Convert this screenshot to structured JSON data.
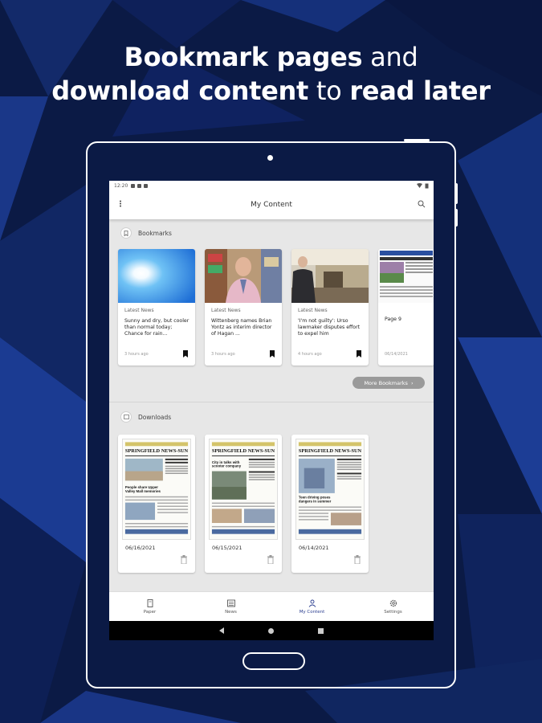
{
  "headline": {
    "line1_bold": "Bookmark pages",
    "line1_light": "and",
    "line2_bold": "download content",
    "line2_light": "to",
    "line2_bold2": "read later"
  },
  "status_bar": {
    "time": "12:20"
  },
  "app_bar": {
    "title": "My Content"
  },
  "bookmarks": {
    "header": "Bookmarks",
    "items": [
      {
        "category": "Latest News",
        "text": "Sunny and dry, but cooler than normal today; Chance for rain...",
        "time": "3 hours ago",
        "image": "sun-sky"
      },
      {
        "category": "Latest News",
        "text": "Wittenberg names Brian Yontz as interim director of Hagan ...",
        "time": "3 hours ago",
        "image": "man-portrait"
      },
      {
        "category": "Latest News",
        "text": "'I'm not guilty': Urso lawmaker disputes effort to expel him",
        "time": "4 hours ago",
        "image": "courtroom"
      },
      {
        "category": "",
        "text": "Page 9",
        "time": "06/14/2021",
        "image": "newspaper-page"
      }
    ],
    "more_label": "More Bookmarks"
  },
  "downloads": {
    "header": "Downloads",
    "items": [
      {
        "date": "06/16/2021",
        "masthead": "SPRINGFIELD NEWS-SUN",
        "headline": "People share Upper Valley Mall memories"
      },
      {
        "date": "06/15/2021",
        "masthead": "SPRINGFIELD NEWS-SUN",
        "headline": "City in talks with scooter company"
      },
      {
        "date": "06/14/2021",
        "masthead": "SPRINGFIELD NEWS-SUN",
        "headline": "Teen driving poses dangers in summer"
      }
    ]
  },
  "bottom_nav": {
    "items": [
      {
        "label": "Paper",
        "icon": "paper-icon",
        "active": false
      },
      {
        "label": "News",
        "icon": "news-icon",
        "active": false
      },
      {
        "label": "My Content",
        "icon": "person-icon",
        "active": true
      },
      {
        "label": "Settings",
        "icon": "gear-icon",
        "active": false
      }
    ]
  },
  "colors": {
    "background": "#0b1a45",
    "accent": "#2a3d8f",
    "more_button": "#9a9a9a"
  }
}
